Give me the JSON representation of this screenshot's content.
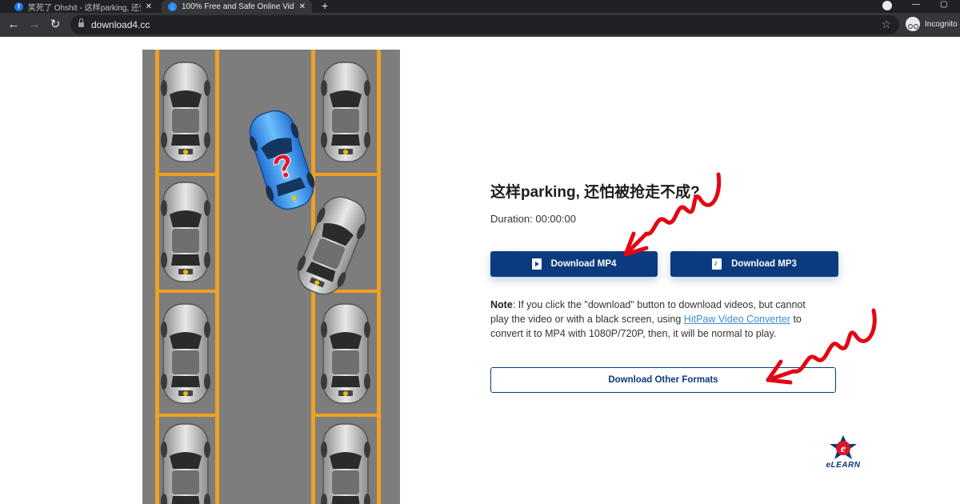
{
  "browser": {
    "tabs": [
      {
        "title": "笑死了 Ohshit - 这样parking, 还怕...",
        "favicon": "facebook-icon",
        "active": false
      },
      {
        "title": "100% Free and Safe Online Video...",
        "favicon": "download-site-icon",
        "active": true
      }
    ],
    "new_tab_symbol": "+",
    "url": "download4.cc",
    "profile_label": "Incognito"
  },
  "video": {
    "title": "这样parking, 还怕被抢走不成?",
    "duration": "Duration: 00:00:00"
  },
  "buttons": {
    "mp4": "Download MP4",
    "mp3": "Download MP3",
    "other": "Download Other Formats"
  },
  "note": {
    "label": "Note",
    "text_before": ": If you click the \"download\" button to download videos, but cannot play the video or with a black screen, using ",
    "link": "HitPaw Video Converter",
    "text_after": " to convert it to MP4 with 1080P/720P, then, it will be normal to play."
  },
  "watermark": {
    "label": "eLEARN"
  },
  "colors": {
    "primary": "#0b3a7e",
    "link": "#3d8bd6",
    "arrow": "#e30613",
    "parking_lines": "#f0a020",
    "asphalt": "#7d7d7d"
  }
}
